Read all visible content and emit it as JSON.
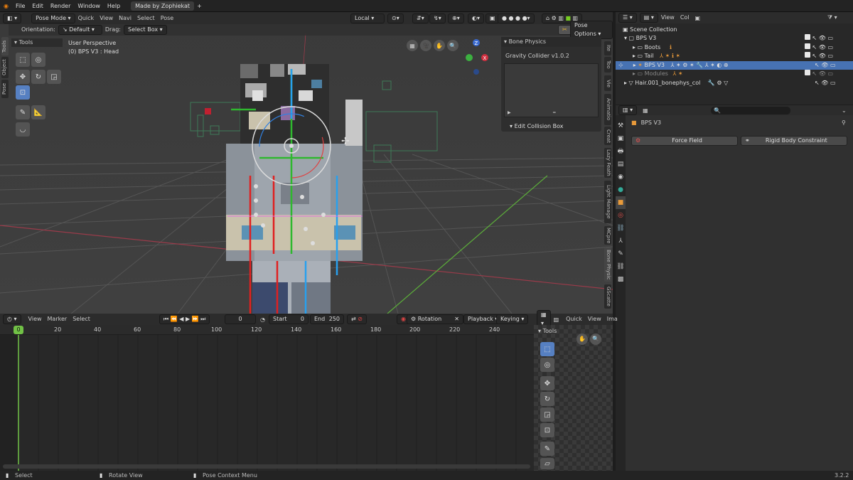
{
  "menubar": {
    "items": [
      "File",
      "Edit",
      "Render",
      "Window",
      "Help"
    ],
    "workspace": "Made by Zophiekat"
  },
  "viewport_header": {
    "mode": "Pose Mode",
    "menus": [
      "Quick",
      "View",
      "Navi",
      "Select",
      "Pose"
    ],
    "transform_orientation": "Local"
  },
  "tool_header": {
    "orientation_label": "Orientation:",
    "orientation_value": "Default",
    "drag_label": "Drag:",
    "drag_value": "Select Box",
    "pose_options": "Pose Options"
  },
  "viewport": {
    "perspective": "User Perspective",
    "object_info": "(0) BPS V3 : Head",
    "tools_tab": "Tools"
  },
  "left_tabs": [
    "Tools",
    "Object",
    "Pose"
  ],
  "right_tabs": [
    "Ite",
    "Too",
    "Vie",
    "Animatio",
    "Creat",
    "Lazy Feath",
    "Light Manage",
    "MCpre",
    "Bone Physic",
    "GScatte"
  ],
  "bone_physics": {
    "title": "Bone Physics",
    "version": "Gravity Collider v1.0.2",
    "collision": "Edit Collision Box"
  },
  "outliner": {
    "menus": [
      "View",
      "Col"
    ],
    "rows": [
      {
        "label": "Scene Collection"
      },
      {
        "label": "BPS V3"
      },
      {
        "label": "Boots"
      },
      {
        "label": "Tail"
      },
      {
        "label": "BPS V3"
      },
      {
        "label": "Modules"
      },
      {
        "label": "Hair.001_bonephys_col"
      }
    ]
  },
  "properties": {
    "object_name": "BPS V3",
    "force_field": "Force Field",
    "rigid_body": "Rigid Body Constraint"
  },
  "timeline": {
    "menus": [
      "View",
      "Marker",
      "Select"
    ],
    "current_frame": "0",
    "start_label": "Start",
    "start": "0",
    "end_label": "End",
    "end": "250",
    "keyingset": "Rotation",
    "playback": "Playback",
    "keying": "Keying",
    "ruler": [
      "0",
      "20",
      "40",
      "60",
      "80",
      "100",
      "120",
      "140",
      "160",
      "180",
      "200",
      "220",
      "240"
    ]
  },
  "tool_panel": {
    "menus": [
      "Quick",
      "View",
      "Ima"
    ],
    "title": "Tools"
  },
  "statusbar": {
    "select": "Select",
    "rotate": "Rotate View",
    "context": "Pose Context Menu",
    "version": "3.2.2"
  },
  "colors": {
    "accent": "#4772b3",
    "active_tool": "#5680c2",
    "playhead": "#71c146",
    "bg": "#3f3f3f"
  }
}
